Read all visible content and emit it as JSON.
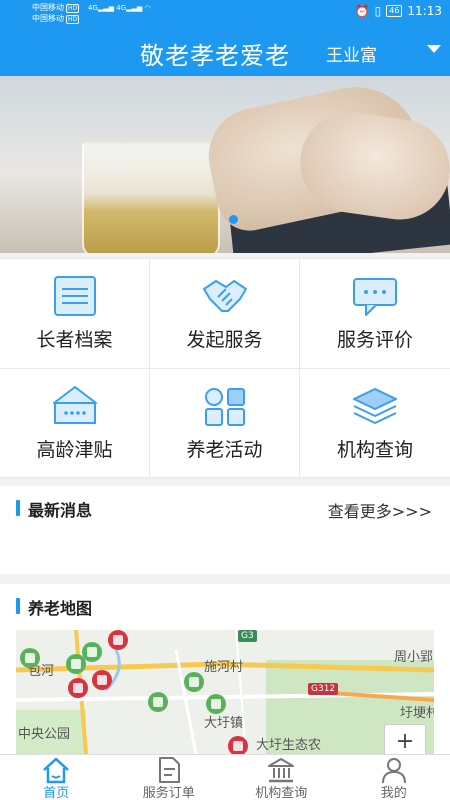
{
  "status_bar": {
    "carrier_1": "中国移动",
    "carrier_2": "中国移动",
    "hd_badge": "HD",
    "signal": "4G",
    "battery": "46",
    "time": "11:13"
  },
  "header": {
    "title": "敬老孝老爱老",
    "user_name": "王业富",
    "bg_color": "#1d99f2"
  },
  "banner": {
    "image": "elderly-hands-with-tea-glass",
    "active_slide": 1
  },
  "services": [
    {
      "label": "长者档案",
      "icon": "profile-card-icon"
    },
    {
      "label": "发起服务",
      "icon": "handshake-icon"
    },
    {
      "label": "服务评价",
      "icon": "comment-bubble-icon"
    },
    {
      "label": "高龄津贴",
      "icon": "subsidy-house-icon"
    },
    {
      "label": "养老活动",
      "icon": "activity-grid-icon"
    },
    {
      "label": "机构查询",
      "icon": "layers-icon"
    }
  ],
  "news": {
    "title": "最新消息",
    "more": "查看更多>>>"
  },
  "map_section": {
    "title": "养老地图",
    "labels": {
      "village": "施河村",
      "town": "大圩镇",
      "eco": "大圩生态农",
      "park": "中央公园",
      "baohe": "包河",
      "zhouxiao": "周小郢",
      "yugeng": "圩埂村",
      "road_g312": "G312",
      "road_g3": "G3",
      "zoom": "+"
    }
  },
  "tabs": [
    {
      "label": "首页",
      "icon": "home-icon",
      "active": true
    },
    {
      "label": "服务订单",
      "icon": "order-document-icon",
      "active": false
    },
    {
      "label": "机构查询",
      "icon": "institution-icon",
      "active": false
    },
    {
      "label": "我的",
      "icon": "person-icon",
      "active": false
    }
  ]
}
